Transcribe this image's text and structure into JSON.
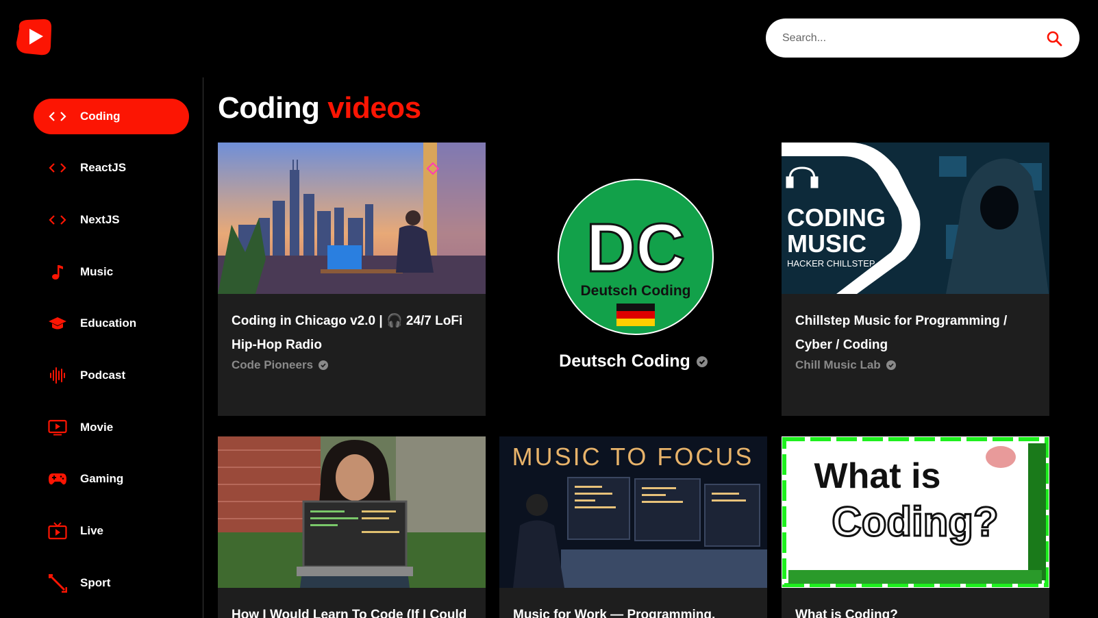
{
  "header": {
    "logo_icon": "play-logo-icon",
    "search": {
      "placeholder": "Search...",
      "icon": "search-icon"
    }
  },
  "colors": {
    "accent": "#fc1503",
    "background": "#000000",
    "card": "#1e1e1e",
    "muted": "#8a8a8a"
  },
  "sidebar": {
    "items": [
      {
        "label": "Coding",
        "icon": "code-icon",
        "active": true
      },
      {
        "label": "ReactJS",
        "icon": "code-icon"
      },
      {
        "label": "NextJS",
        "icon": "code-icon"
      },
      {
        "label": "Music",
        "icon": "music-note-icon"
      },
      {
        "label": "Education",
        "icon": "graduation-cap-icon"
      },
      {
        "label": "Podcast",
        "icon": "soundwave-icon"
      },
      {
        "label": "Movie",
        "icon": "play-screen-icon"
      },
      {
        "label": "Gaming",
        "icon": "gamepad-icon"
      },
      {
        "label": "Live",
        "icon": "tv-icon"
      },
      {
        "label": "Sport",
        "icon": "sport-icon"
      }
    ]
  },
  "main": {
    "title_part1": "Coding",
    "title_part2": "videos",
    "videos": [
      {
        "title": "Coding in Chicago v2.0 | 🎧 24/7 LoFi Hip-Hop Radio",
        "channel": "Code Pioneers"
      },
      {
        "title": "Chillstep Music for Programming / Cyber / Coding",
        "channel": "Chill Music Lab",
        "thumb_text_1": "CODING",
        "thumb_text_2": "MUSIC",
        "thumb_text_3": "HACKER CHILLSTEP"
      },
      {
        "title": "How I Would Learn To Code (If I Could"
      },
      {
        "title": "Music for Work — Programming,",
        "thumb_text": "MUSIC TO FOCUS"
      },
      {
        "title": "What is Coding?",
        "thumb_text_1": "What is",
        "thumb_text_2": "Coding?"
      }
    ],
    "channel": {
      "name": "Deutsch Coding",
      "logo_text": "DC",
      "logo_sub": "Deutsch Coding"
    }
  }
}
